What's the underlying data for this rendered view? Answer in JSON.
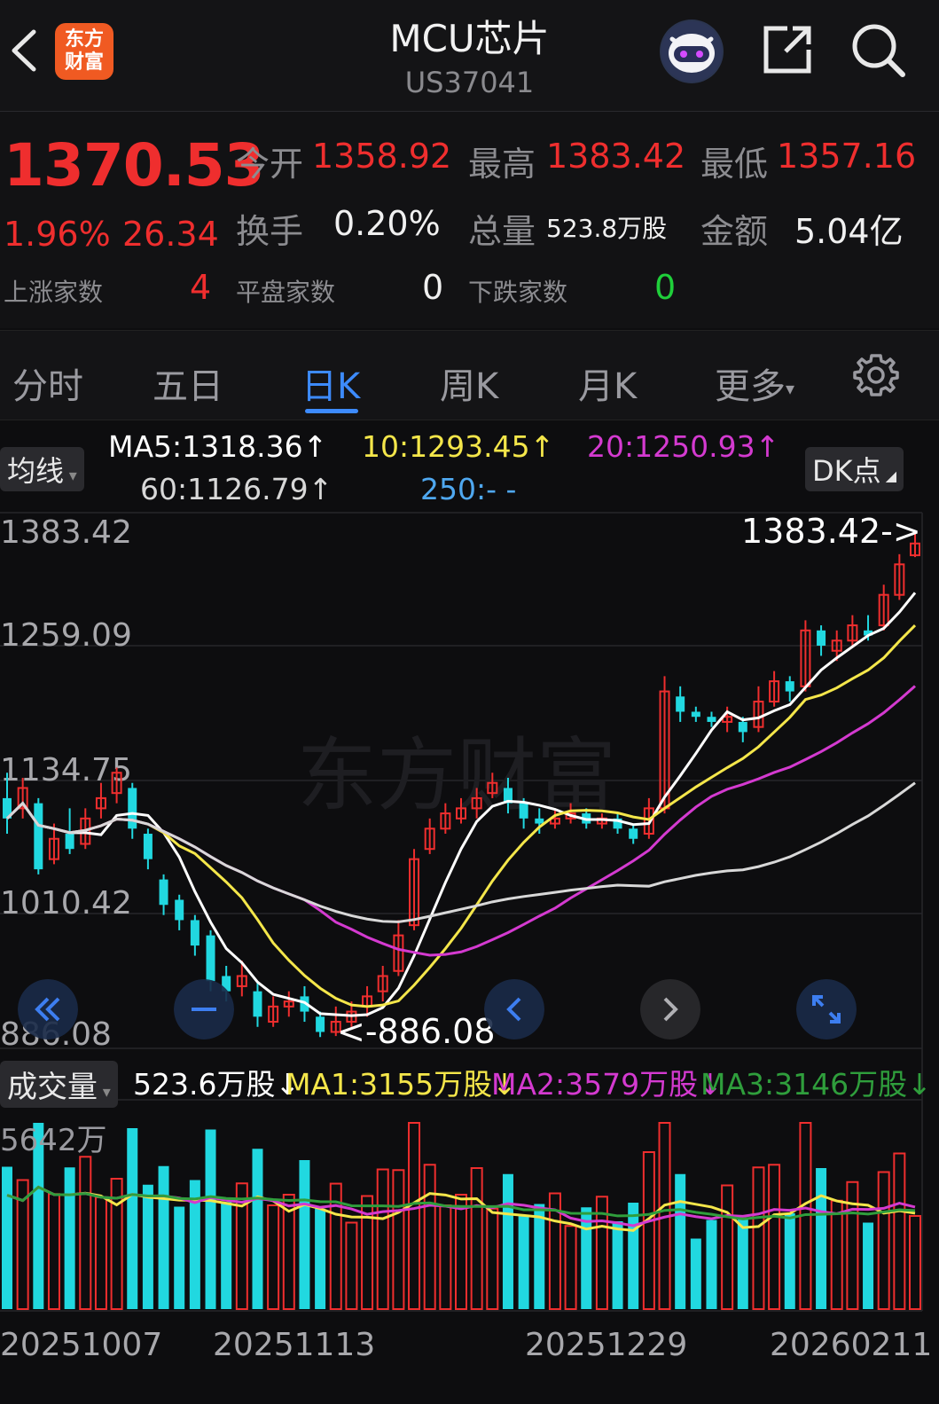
{
  "header": {
    "title": "MCU芯片",
    "code": "US37041",
    "logo_line1": "东方",
    "logo_line2": "财富"
  },
  "quote": {
    "price": "1370.53",
    "change_pct": "1.96%",
    "change": "26.34",
    "open_label": "今开",
    "open": "1358.92",
    "high_label": "最高",
    "high": "1383.42",
    "low_label": "最低",
    "low": "1357.16",
    "turnover_label": "换手",
    "turnover": "0.20%",
    "volume_label": "总量",
    "volume": "523.8万股",
    "amount_label": "金额",
    "amount": "5.04亿",
    "up_label": "上涨家数",
    "up": "4",
    "flat_label": "平盘家数",
    "flat": "0",
    "down_label": "下跌家数",
    "down": "0"
  },
  "tabs": [
    "分时",
    "五日",
    "日K",
    "周K",
    "月K",
    "更多"
  ],
  "active_tab": "日K",
  "ma_legend": {
    "selector": "均线",
    "ma5": "MA5:1318.36↑",
    "ma10": "10:1293.45↑",
    "ma20": "20:1250.93↑",
    "ma60": "60:1126.79↑",
    "ma250": "250:- -",
    "dk": "DK点"
  },
  "colors": {
    "up": "#ef2e2e",
    "down": "#21d8e0",
    "ma5": "#ffffff",
    "ma10": "#f4e64a",
    "ma20": "#d43ad0",
    "ma60": "#d8d8d8",
    "vol_ma3": "#2f9e3c",
    "accent": "#3d8bfd"
  },
  "price_axis": [
    "1383.42",
    "1259.09",
    "1134.75",
    "1010.42",
    "886.08"
  ],
  "max_label": "1383.42->",
  "min_label": "<-886.08",
  "watermark": "东方财富",
  "volume_legend": {
    "selector": "成交量",
    "vol": "523.6万股↓",
    "ma1": "MA1:3155万股↓",
    "ma2": "MA2:3579万股↓",
    "ma3": "MA3:3146万股↓",
    "axis_max": "5642万"
  },
  "date_axis": [
    "20251007",
    "20251113",
    "20251229",
    "20260211"
  ],
  "chart_data": {
    "type": "candlestick",
    "ylim": [
      886.08,
      1383.42
    ],
    "candles": [
      [
        1120,
        1100,
        1145,
        1085
      ],
      [
        1110,
        1130,
        1140,
        1100
      ],
      [
        1115,
        1050,
        1120,
        1045
      ],
      [
        1060,
        1080,
        1095,
        1055
      ],
      [
        1085,
        1070,
        1110,
        1065
      ],
      [
        1075,
        1100,
        1110,
        1070
      ],
      [
        1110,
        1120,
        1135,
        1100
      ],
      [
        1125,
        1145,
        1150,
        1115
      ],
      [
        1130,
        1090,
        1135,
        1080
      ],
      [
        1085,
        1060,
        1090,
        1050
      ],
      [
        1040,
        1015,
        1045,
        1005
      ],
      [
        1020,
        1000,
        1025,
        990
      ],
      [
        1000,
        975,
        1005,
        965
      ],
      [
        985,
        940,
        990,
        930
      ],
      [
        945,
        930,
        955,
        920
      ],
      [
        935,
        945,
        960,
        925
      ],
      [
        930,
        905,
        940,
        895
      ],
      [
        900,
        915,
        925,
        895
      ],
      [
        915,
        920,
        930,
        905
      ],
      [
        925,
        910,
        935,
        900
      ],
      [
        905,
        890,
        910,
        885
      ],
      [
        890,
        900,
        915,
        886
      ],
      [
        900,
        910,
        920,
        895
      ],
      [
        915,
        925,
        935,
        905
      ],
      [
        930,
        945,
        955,
        920
      ],
      [
        950,
        985,
        1000,
        945
      ],
      [
        995,
        1060,
        1070,
        990
      ],
      [
        1070,
        1090,
        1100,
        1065
      ],
      [
        1090,
        1105,
        1115,
        1085
      ],
      [
        1100,
        1110,
        1120,
        1095
      ],
      [
        1110,
        1120,
        1130,
        1100
      ],
      [
        1125,
        1135,
        1145,
        1120
      ],
      [
        1130,
        1115,
        1140,
        1105
      ],
      [
        1115,
        1100,
        1120,
        1090
      ],
      [
        1100,
        1095,
        1110,
        1085
      ],
      [
        1095,
        1100,
        1110,
        1090
      ],
      [
        1100,
        1105,
        1115,
        1095
      ],
      [
        1105,
        1095,
        1110,
        1090
      ],
      [
        1095,
        1100,
        1105,
        1090
      ],
      [
        1100,
        1090,
        1105,
        1085
      ],
      [
        1090,
        1080,
        1095,
        1075
      ],
      [
        1085,
        1110,
        1120,
        1080
      ],
      [
        1110,
        1225,
        1240,
        1105
      ],
      [
        1220,
        1205,
        1230,
        1195
      ],
      [
        1205,
        1200,
        1210,
        1195
      ],
      [
        1200,
        1195,
        1205,
        1190
      ],
      [
        1195,
        1200,
        1210,
        1185
      ],
      [
        1195,
        1185,
        1200,
        1175
      ],
      [
        1190,
        1215,
        1230,
        1185
      ],
      [
        1215,
        1235,
        1245,
        1210
      ],
      [
        1235,
        1225,
        1240,
        1215
      ],
      [
        1230,
        1285,
        1295,
        1225
      ],
      [
        1285,
        1270,
        1290,
        1260
      ],
      [
        1265,
        1275,
        1285,
        1255
      ],
      [
        1275,
        1290,
        1300,
        1270
      ],
      [
        1285,
        1280,
        1300,
        1275
      ],
      [
        1290,
        1320,
        1330,
        1285
      ],
      [
        1320,
        1350,
        1360,
        1315
      ],
      [
        1358.92,
        1370.53,
        1383.42,
        1357.16
      ]
    ]
  }
}
